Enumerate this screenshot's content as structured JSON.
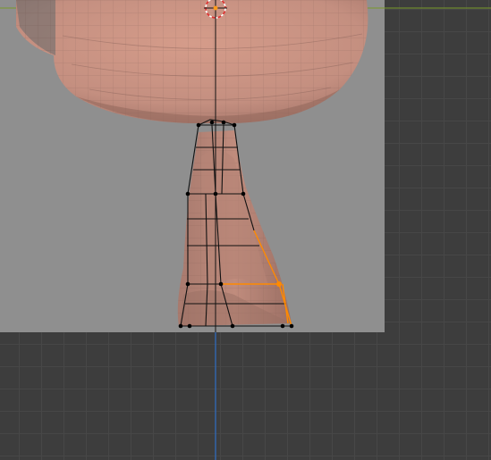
{
  "viewport": {
    "background_color": "#3d3d3d",
    "grid_color": "#474747",
    "reference_image_color": "#8f8f8f",
    "x_axis_color": "#7a9a2a",
    "z_axis_color": "#2f6fc4",
    "mesh_color": "#c48f80",
    "selection_color": "#ff8a00",
    "icons": [
      "3d-cursor-icon",
      "origin-point-icon"
    ]
  }
}
